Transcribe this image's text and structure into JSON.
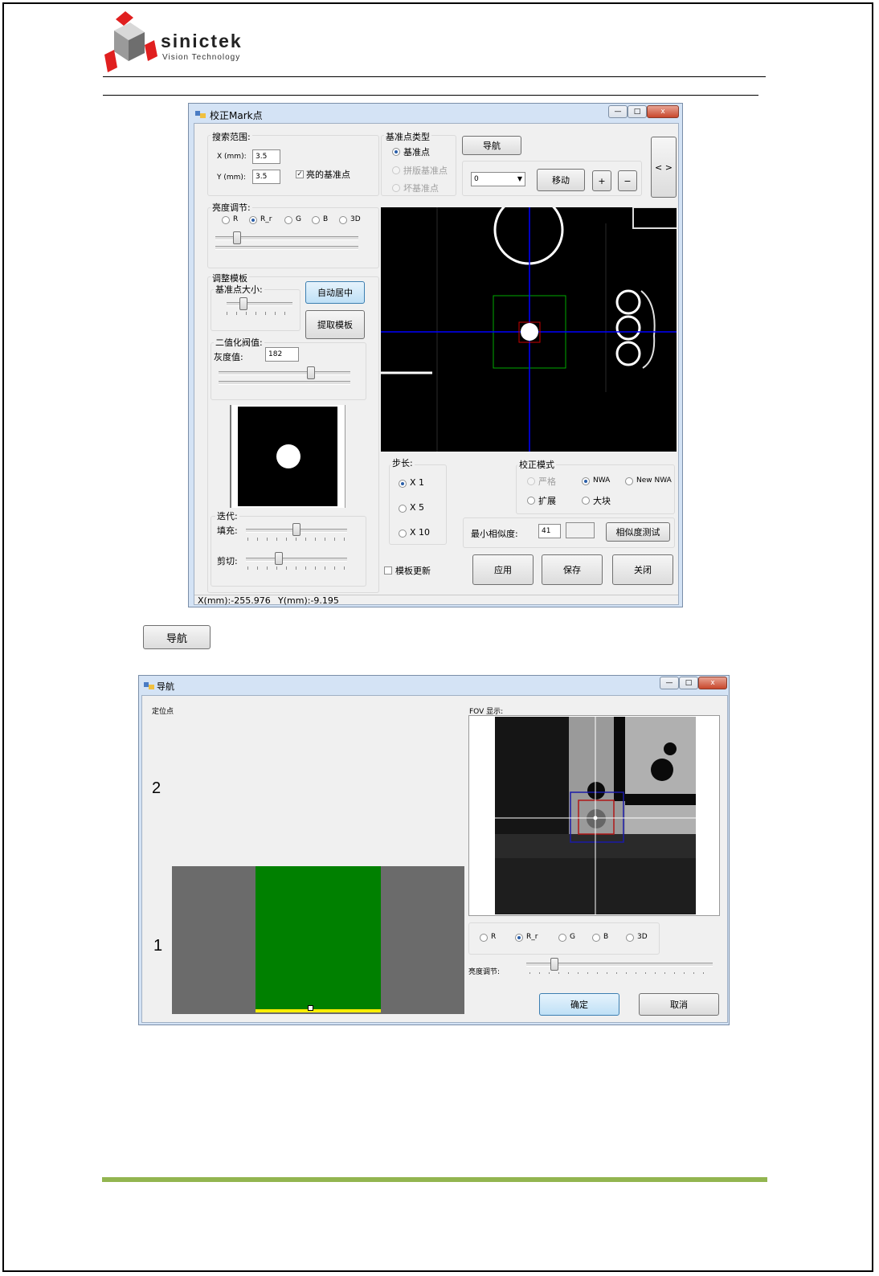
{
  "logo": {
    "name": "sinictek",
    "tagline": "Vision Technology"
  },
  "calib_window": {
    "title": "校正Mark点",
    "controls": {
      "min": "—",
      "max": "□",
      "close": "x"
    },
    "search": {
      "label": "搜索范围:",
      "x_label": "X (mm):",
      "x_value": "3.5",
      "y_label": "Y (mm):",
      "y_value": "3.5",
      "bright_label": "亮的基准点",
      "bright_checked": true
    },
    "fiducial_type": {
      "label": "基准点类型",
      "options": [
        {
          "label": "基准点",
          "selected": true,
          "disabled": false
        },
        {
          "label": "拼版基准点",
          "selected": false,
          "disabled": true
        },
        {
          "label": "坏基准点",
          "selected": false,
          "disabled": true
        }
      ]
    },
    "nav_button": "导航",
    "expand_button": "< >",
    "nav_combo_value": "0",
    "move_button": "移动",
    "plus_button": "+",
    "minus_button": "−",
    "brightness": {
      "label": "亮度调节:",
      "options": [
        "R",
        "R_r",
        "G",
        "B",
        "3D"
      ],
      "selected": "R_r",
      "slider_level": 0.15
    },
    "template": {
      "label": "调整模板",
      "size_label": "基准点大小:",
      "size_level": 0.2,
      "auto_center_button": "自动居中",
      "extract_button": "提取模板",
      "threshold_label": "二值化阀值:",
      "gray_label": "灰度值:",
      "gray_value": "182",
      "threshold_level": 0.71
    },
    "iteration": {
      "label": "迭代:",
      "fill_label": "填充:",
      "fill_level": 0.5,
      "cut_label": "剪切:",
      "cut_level": 0.32
    },
    "step": {
      "label": "步长:",
      "options": [
        "X 1",
        "X 5",
        "X 10"
      ],
      "selected": "X 1"
    },
    "calib_mode": {
      "label": "校正模式",
      "options": [
        {
          "label": "严格",
          "selected": false,
          "disabled": true
        },
        {
          "label": "NWA",
          "selected": true,
          "disabled": false
        },
        {
          "label": "New NWA",
          "selected": false,
          "disabled": false
        },
        {
          "label": "扩展",
          "selected": false,
          "disabled": false
        },
        {
          "label": "大块",
          "selected": false,
          "disabled": false
        }
      ]
    },
    "similarity": {
      "label": "最小相似度:",
      "value": "41",
      "result": "",
      "test_button": "相似度测试"
    },
    "template_update_label": "模板更新",
    "template_update_checked": false,
    "apply_button": "应用",
    "save_button": "保存",
    "close_button": "关闭",
    "status": {
      "x": "X(mm):-255.976",
      "y": "Y(mm):-9.195"
    }
  },
  "nav_caption_button": "导航",
  "nav_window": {
    "title": "导航",
    "controls": {
      "min": "—",
      "max": "□",
      "close": "x"
    },
    "positioning_label": "定位点",
    "fov_label": "FOV 显示:",
    "marker_2": "2",
    "marker_1": "1",
    "brightness": {
      "options": [
        "R",
        "R_r",
        "G",
        "B",
        "3D"
      ],
      "selected": "R_r",
      "label": "亮度调节:",
      "slider_level": 0.15
    },
    "ok_button": "确定",
    "cancel_button": "取消"
  },
  "colors": {
    "board_green": "#008000",
    "board_gray": "#6b6b6b",
    "board_edge_yellow": "#ffee00",
    "footer_green": "#92b550",
    "crosshair_blue": "#0000ff",
    "roi_green": "#00aa00"
  }
}
